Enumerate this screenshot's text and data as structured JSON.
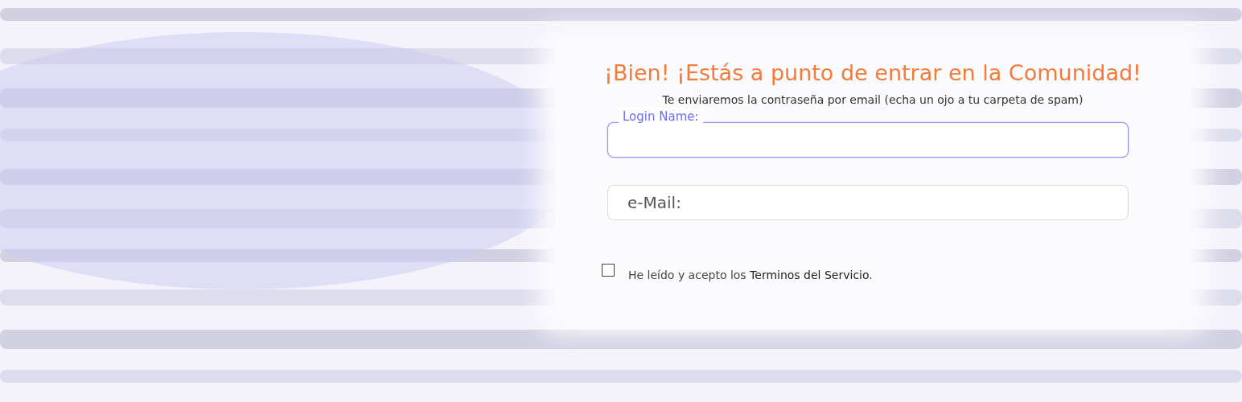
{
  "form": {
    "title": "¡Bien! ¡Estás a punto de entrar en la Comunidad!",
    "subtitle": "Te enviaremos la contraseña por email (echa un ojo a tu carpeta de spam)",
    "fields": [
      {
        "kind": "floating",
        "label": "Login Name:",
        "focused": true
      },
      {
        "kind": "placeholder",
        "placeholder": "e-Mail:",
        "focused": false
      }
    ],
    "terms": {
      "checked": false,
      "text": "He leído y acepto los ",
      "link": "Terminos del Servicio",
      "end": "."
    }
  }
}
